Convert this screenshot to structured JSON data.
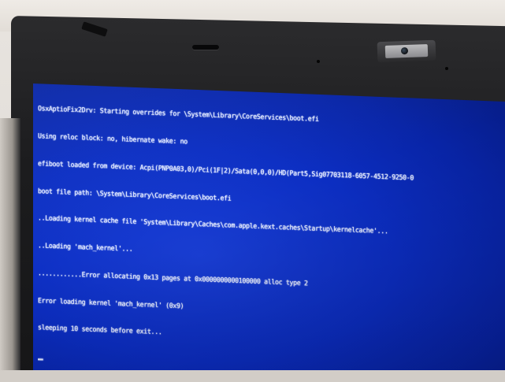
{
  "console": {
    "lines": [
      "OsxAptioFix2Drv: Starting overrides for \\System\\Library\\CoreServices\\boot.efi",
      "Using reloc block: no, hibernate wake: no",
      "efiboot loaded from device: Acpi(PNP0A03,0)/Pci(1F|2)/Sata(0,0,0)/HD(Part5,Sig07703118-6057-4512-9250-0",
      "boot file path: \\System\\Library\\CoreServices\\boot.efi",
      "..Loading kernel cache file 'System\\Library\\Caches\\com.apple.kext.caches\\Startup\\kernelcache'...",
      "..Loading 'mach_kernel'...",
      "............Error allocating 0x13 pages at 0x0000000000100000 alloc type 2",
      "Error loading kernel 'mach_kernel' (0x9)",
      "sleeping 10 seconds before exit..."
    ],
    "cursor": "_"
  },
  "colors": {
    "screen_blue": "#0c2ec2",
    "console_text": "#e6ecff",
    "bezel": "#1c1c1e"
  }
}
